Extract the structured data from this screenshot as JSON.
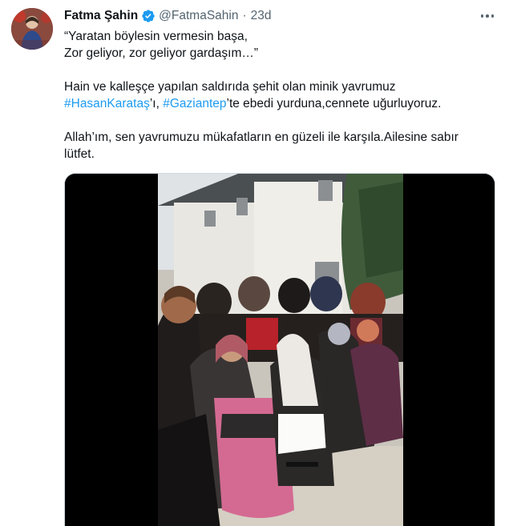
{
  "tweet": {
    "author_name": "Fatma Şahin",
    "handle": "@FatmaSahin",
    "separator": "·",
    "time": "23d",
    "quote_line1": "“Yaratan böylesin vermesin başa,",
    "quote_line2": "Zor geliyor, zor geliyor gardaşım…”",
    "para2_line1": "Hain ve kalleşçe yapılan saldırıda şehit olan minik yavrumuz",
    "hashtag1": "#HasanKarataş",
    "suffix1": "’ı, ",
    "hashtag2": "#Gaziantep",
    "suffix2": "’te ebedi yurduna,cennete uğurluyoruz.",
    "para3": "Allah’ım, sen yavrumuzu mükafatların en güzeli ile karşıla.Ailesine sabır lütfet."
  },
  "icons": {
    "verified": "verified-badge-icon",
    "more": "more-options-icon"
  },
  "colors": {
    "text": "#0f1419",
    "secondary": "#536471",
    "link": "#1d9bf0",
    "verified": "#1d9bf0"
  }
}
